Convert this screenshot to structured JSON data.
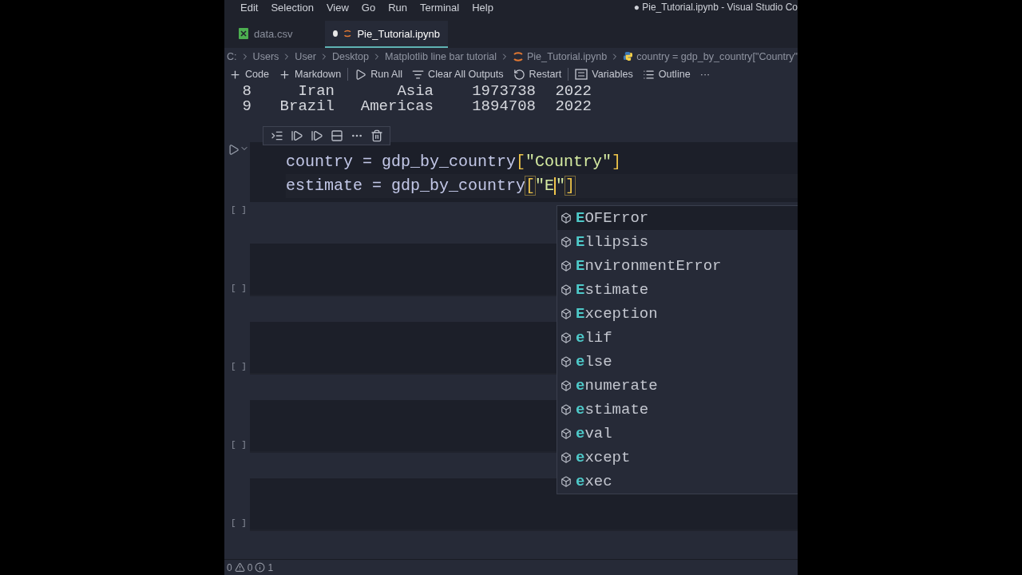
{
  "menu_bar": {
    "items": [
      "Edit",
      "Selection",
      "View",
      "Go",
      "Run",
      "Terminal",
      "Help"
    ],
    "title": "● Pie_Tutorial.ipynb - Visual Studio Co"
  },
  "tabs": [
    {
      "label": "data.csv",
      "kind": "csv",
      "selected": false,
      "dirty": false
    },
    {
      "label": "Pie_Tutorial.ipynb",
      "kind": "notebook",
      "selected": true,
      "dirty": true
    }
  ],
  "breadcrumb": [
    {
      "label": "C:",
      "kind": "folder"
    },
    {
      "label": "Users",
      "kind": "folder"
    },
    {
      "label": "User",
      "kind": "folder"
    },
    {
      "label": "Desktop",
      "kind": "folder"
    },
    {
      "label": "Matplotlib line bar tutorial",
      "kind": "folder"
    },
    {
      "label": "Pie_Tutorial.ipynb",
      "kind": "notebook"
    },
    {
      "label": "country = gdp_by_country[\"Country\"",
      "kind": "symbol"
    }
  ],
  "toolbar": [
    {
      "label": "Code",
      "kind": "plus"
    },
    {
      "label": "Markdown",
      "kind": "plus"
    },
    {
      "kind": "separator"
    },
    {
      "label": "Run All",
      "kind": "run"
    },
    {
      "label": "Clear All Outputs",
      "kind": "clear"
    },
    {
      "label": "Restart",
      "kind": "restart"
    },
    {
      "kind": "separator"
    },
    {
      "label": "Variables",
      "kind": "variables"
    },
    {
      "label": "Outline",
      "kind": "outline"
    },
    {
      "label": "···",
      "kind": "more"
    }
  ],
  "output_rows": [
    [
      "8",
      "Iran",
      "Asia",
      "1973738",
      "2022"
    ],
    [
      "9",
      "Brazil",
      "Americas",
      "1894708",
      "2022"
    ]
  ],
  "code_cell": {
    "execution_label": "[ ]",
    "lines": [
      [
        {
          "text": "country",
          "kind": "name"
        },
        {
          "text": " = ",
          "kind": "op"
        },
        {
          "text": "gdp_by_country",
          "kind": "name"
        },
        {
          "text": "[",
          "kind": "bracket"
        },
        {
          "text": "\"Country\"",
          "kind": "string"
        },
        {
          "text": "]",
          "kind": "bracket"
        }
      ],
      [
        {
          "text": "estimate",
          "kind": "name"
        },
        {
          "text": " = ",
          "kind": "op"
        },
        {
          "text": "gdp_by_country",
          "kind": "name"
        },
        {
          "text": "[",
          "kind": "bracket"
        },
        {
          "text": "\"E",
          "kind": "string"
        },
        {
          "text": "\"",
          "kind": "string"
        },
        {
          "text": "]",
          "kind": "bracket"
        }
      ]
    ]
  },
  "empty_cells": [
    {
      "execution_label": "[ ]"
    },
    {
      "execution_label": "[ ]"
    },
    {
      "execution_label": "[ ]"
    },
    {
      "execution_label": "[ ]"
    }
  ],
  "suggestions": [
    {
      "label": "EOFError",
      "selected": true
    },
    {
      "label": "Ellipsis",
      "selected": false
    },
    {
      "label": "EnvironmentError",
      "selected": false
    },
    {
      "label": "Estimate",
      "selected": false
    },
    {
      "label": "Exception",
      "selected": false
    },
    {
      "label": "elif",
      "selected": false
    },
    {
      "label": "else",
      "selected": false
    },
    {
      "label": "enumerate",
      "selected": false
    },
    {
      "label": "estimate",
      "selected": false
    },
    {
      "label": "eval",
      "selected": false
    },
    {
      "label": "except",
      "selected": false
    },
    {
      "label": "exec",
      "selected": false
    }
  ],
  "status_bar": {
    "errors": "0",
    "warnings": "0",
    "info": "1"
  }
}
